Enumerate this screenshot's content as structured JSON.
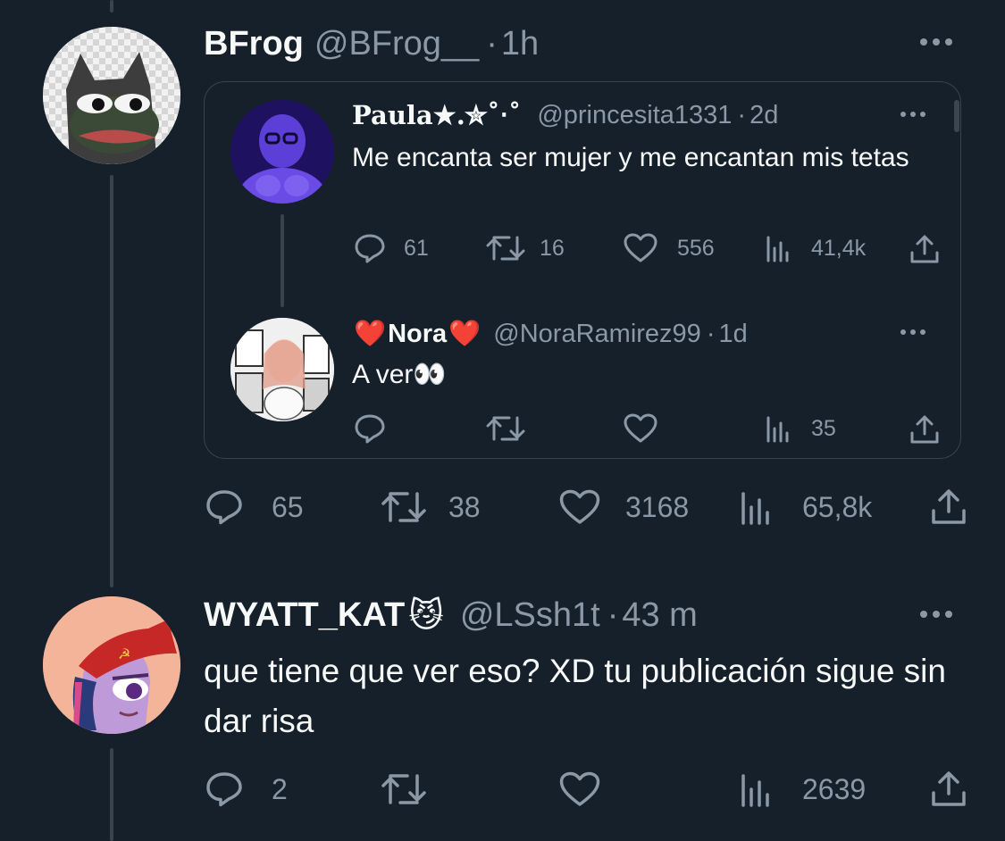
{
  "tweet_main": {
    "display_name": "BFrog",
    "handle": "@BFrog__",
    "separator": "·",
    "time": "1h",
    "actions": {
      "replies": "65",
      "retweets": "38",
      "likes": "3168",
      "views": "65,8k"
    }
  },
  "quoted_tweet_1": {
    "display_name": "Paula★.✮˚‧˚",
    "handle": "@princesita1331",
    "separator": "·",
    "time": "2d",
    "text": "Me encanta ser mujer y me encantan mis tetas",
    "actions": {
      "replies": "61",
      "retweets": "16",
      "likes": "556",
      "views": "41,4k"
    }
  },
  "quoted_tweet_2": {
    "display_name_prefix": "❤️",
    "display_name": "Nora",
    "display_name_suffix": "❤️",
    "handle": "@NoraRamirez99",
    "separator": "·",
    "time": "1d",
    "text": "A ver👀",
    "actions": {
      "views": "35"
    }
  },
  "reply_tweet": {
    "display_name": "WYATT_KAT",
    "display_name_emoji": "😼",
    "handle": "@LSsh1t",
    "separator": "·",
    "time": "43 m",
    "text": "que tiene que ver eso? XD tu publicación sigue sin dar risa",
    "actions": {
      "replies": "2",
      "views": "2639"
    }
  },
  "colors": {
    "background": "#15202b",
    "text_primary": "#f7f9f9",
    "text_muted": "#8b98a5",
    "border": "#38444d"
  },
  "icons": [
    "reply-icon",
    "retweet-icon",
    "like-icon",
    "views-icon",
    "share-icon",
    "more-icon"
  ]
}
